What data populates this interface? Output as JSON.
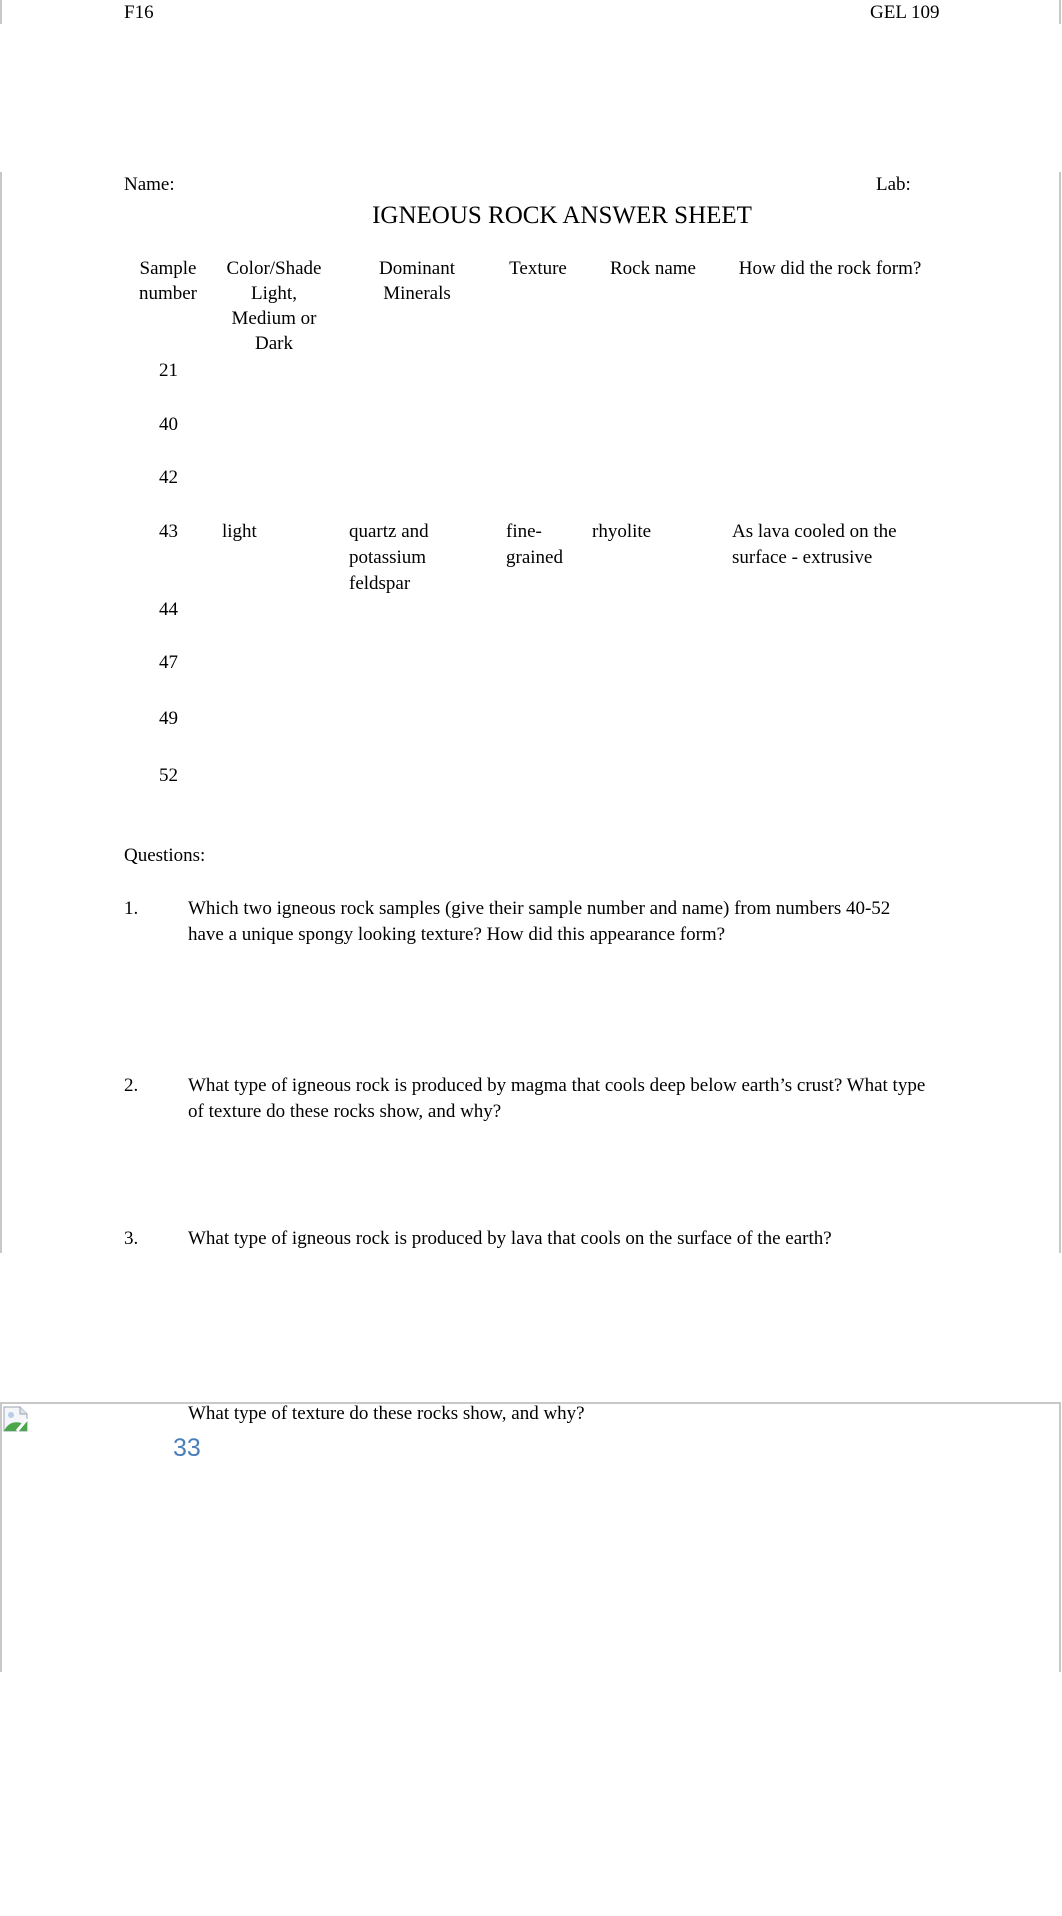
{
  "header": {
    "left": "F16",
    "right": "GEL 109"
  },
  "form": {
    "name_label": "Name:",
    "lab_label": "Lab:"
  },
  "title": "IGNEOUS ROCK ANSWER SHEET",
  "table": {
    "columns": [
      "Sample number",
      "Color/Shade Light, Medium or Dark",
      "Dominant Minerals",
      "Texture",
      "Rock name",
      "How did the rock form?"
    ],
    "rows": [
      {
        "sample": "21",
        "color": "",
        "minerals": "",
        "texture": "",
        "rock_name": "",
        "formation": ""
      },
      {
        "sample": "40",
        "color": "",
        "minerals": "",
        "texture": "",
        "rock_name": "",
        "formation": ""
      },
      {
        "sample": "42",
        "color": "",
        "minerals": "",
        "texture": "",
        "rock_name": "",
        "formation": ""
      },
      {
        "sample": "43",
        "color": "light",
        "minerals": "quartz and potassium feldspar",
        "texture": "fine-grained",
        "rock_name": "rhyolite",
        "formation": "As lava cooled on the surface - extrusive"
      },
      {
        "sample": "44",
        "color": "",
        "minerals": "",
        "texture": "",
        "rock_name": "",
        "formation": ""
      },
      {
        "sample": "47",
        "color": "",
        "minerals": "",
        "texture": "",
        "rock_name": "",
        "formation": ""
      },
      {
        "sample": "49",
        "color": "",
        "minerals": "",
        "texture": "",
        "rock_name": "",
        "formation": ""
      },
      {
        "sample": "52",
        "color": "",
        "minerals": "",
        "texture": "",
        "rock_name": "",
        "formation": ""
      }
    ]
  },
  "questions": {
    "label": "Questions:",
    "items": [
      {
        "number": "1.",
        "text": "Which two igneous rock samples (give their sample number and name) from numbers 40-52 have a unique spongy looking texture?  How did this appearance form?"
      },
      {
        "number": "2.",
        "text": "What type of igneous rock is produced by magma that cools deep below earth’s crust? What type of texture do these rocks show, and why?"
      },
      {
        "number": "3.",
        "text": "What type of igneous rock is produced by lava that cools on the surface of the earth?"
      }
    ],
    "continuation": "What type of texture do these rocks show, and why?"
  },
  "footer": {
    "page_number": "33",
    "broken_image_icon": "broken-image-icon"
  },
  "colors": {
    "page_number": "#4a7ebb",
    "page_border": "#c8c8c8"
  }
}
